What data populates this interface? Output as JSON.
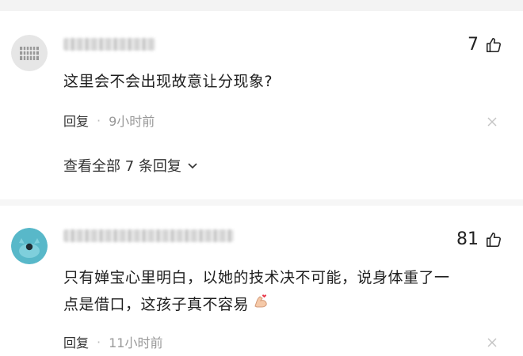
{
  "comments": [
    {
      "likes": "7",
      "text": "这里会不会出现故意让分现象?",
      "reply_label": "回复",
      "separator": "·",
      "time": "9小时前",
      "view_all": "查看全部 7 条回复"
    },
    {
      "likes": "81",
      "text_line1": "只有婵宝心里明白，以她的技术决不可能，说身体重了一",
      "text_line2": "点是借口，这孩子真不容易",
      "reply_label": "回复",
      "separator": "·",
      "time": "11小时前"
    }
  ],
  "icons": {
    "thumbs_up": "thumbs-up-icon",
    "close": "close-icon",
    "chevron": "chevron-down-icon",
    "emoji": "muscle-emoji-icon"
  }
}
